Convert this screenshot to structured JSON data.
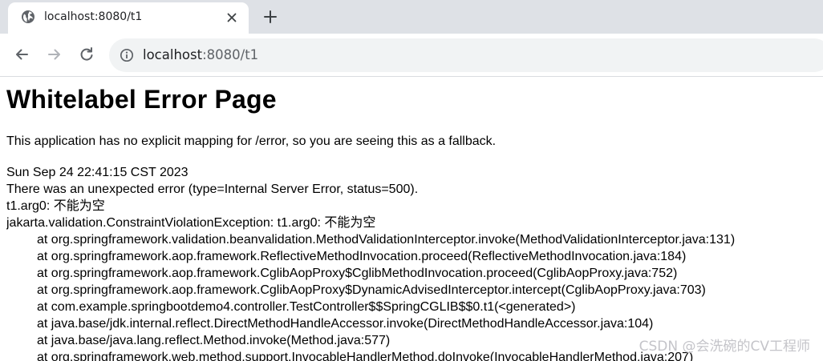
{
  "browser": {
    "tab": {
      "title": "localhost:8080/t1",
      "icon": "globe-icon"
    },
    "omnibox": {
      "host": "localhost",
      "rest": ":8080/t1",
      "icon": "info-icon"
    },
    "buttons": {
      "back": "back-arrow-icon",
      "forward": "forward-arrow-icon",
      "reload": "reload-icon",
      "new_tab": "plus-icon",
      "close_tab": "close-icon"
    }
  },
  "page": {
    "title": "Whitelabel Error Page",
    "fallback": "This application has no explicit mapping for /error, so you are seeing this as a fallback.",
    "timestamp": "Sun Sep 24 22:41:15 CST 2023",
    "status_line": "There was an unexpected error (type=Internal Server Error, status=500).",
    "message": "t1.arg0: 不能为空",
    "exception": "jakarta.validation.ConstraintViolationException: t1.arg0: 不能为空",
    "stack": [
      "at org.springframework.validation.beanvalidation.MethodValidationInterceptor.invoke(MethodValidationInterceptor.java:131)",
      "at org.springframework.aop.framework.ReflectiveMethodInvocation.proceed(ReflectiveMethodInvocation.java:184)",
      "at org.springframework.aop.framework.CglibAopProxy$CglibMethodInvocation.proceed(CglibAopProxy.java:752)",
      "at org.springframework.aop.framework.CglibAopProxy$DynamicAdvisedInterceptor.intercept(CglibAopProxy.java:703)",
      "at com.example.springbootdemo4.controller.TestController$$SpringCGLIB$$0.t1(<generated>)",
      "at java.base/jdk.internal.reflect.DirectMethodHandleAccessor.invoke(DirectMethodHandleAccessor.java:104)",
      "at java.base/java.lang.reflect.Method.invoke(Method.java:577)",
      "at org.springframework.web.method.support.InvocableHandlerMethod.doInvoke(InvocableHandlerMethod.java:207)"
    ]
  },
  "watermark": "CSDN @会洗碗的CV工程师",
  "colors": {
    "tabstrip": "#dee1e6",
    "omnibox": "#f1f3f4",
    "icon": "#5f6368",
    "icon_disabled": "#b0b3b8",
    "text": "#000000"
  }
}
